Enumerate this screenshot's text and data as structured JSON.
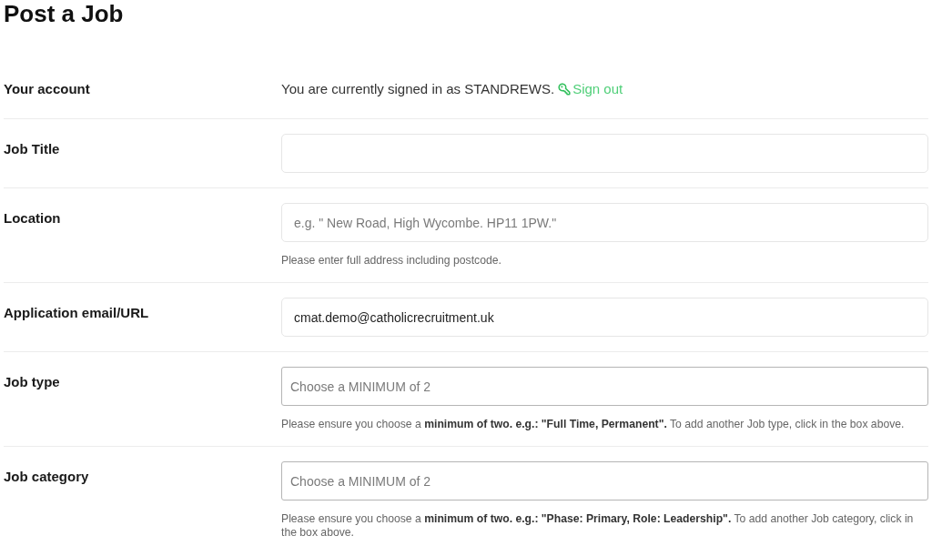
{
  "page": {
    "title": "Post a Job"
  },
  "account": {
    "label": "Your account",
    "text": "You are currently signed in as STANDREWS.",
    "sign_out_link": "Sign out"
  },
  "fields": [
    {
      "kind": "text",
      "label": "Job Title"
    },
    {
      "kind": "text",
      "label": "Location",
      "placeholder": "e.g. \" New Road, High Wycombe. HP11 1PW.\"",
      "help": "Please enter full address including postcode."
    },
    {
      "kind": "text",
      "label": "Application email/URL",
      "value": "cmat.demo@catholicrecruitment.uk"
    },
    {
      "kind": "multiselect",
      "label": "Job type",
      "placeholder": "Choose a MINIMUM of 2",
      "help": "Please ensure you choose a **minimum of two. e.g.: \"Full Time, Permanent\".** To add another Job type, click in the box above."
    },
    {
      "kind": "multiselect",
      "label": "Job category",
      "placeholder": "Choose a MINIMUM of 2",
      "help": "Please ensure you choose a **minimum of two. e.g.: \"Phase: Primary, Role: Leadership\".** To add another Job category, click in the box above."
    }
  ]
}
